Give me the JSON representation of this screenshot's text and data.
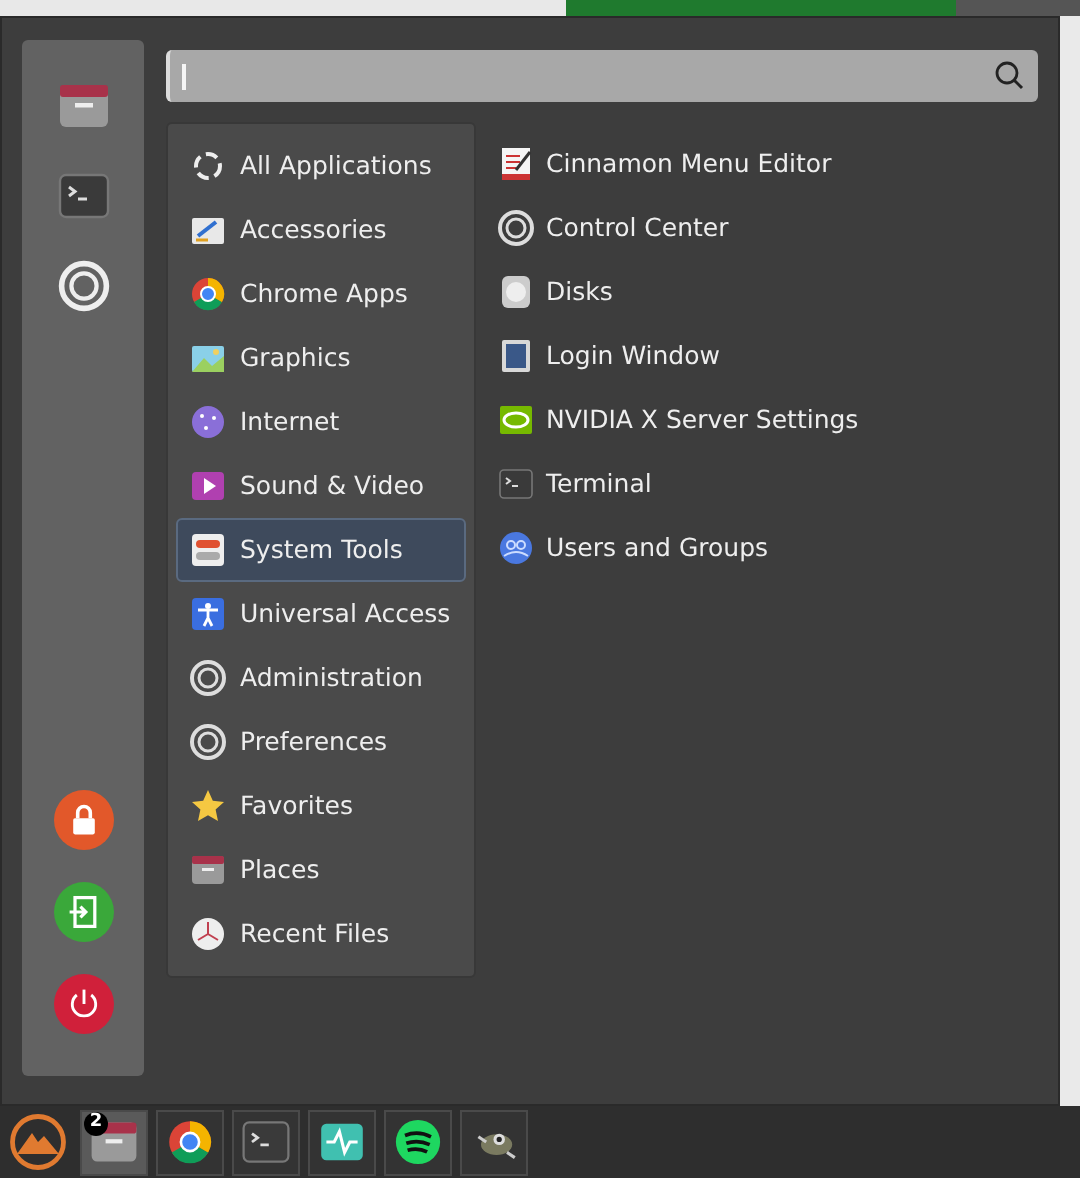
{
  "categories": [
    {
      "label": "All Applications",
      "selected": false
    },
    {
      "label": "Accessories",
      "selected": false
    },
    {
      "label": "Chrome Apps",
      "selected": false
    },
    {
      "label": "Graphics",
      "selected": false
    },
    {
      "label": "Internet",
      "selected": false
    },
    {
      "label": "Sound & Video",
      "selected": false
    },
    {
      "label": "System Tools",
      "selected": true
    },
    {
      "label": "Universal Access",
      "selected": false
    },
    {
      "label": "Administration",
      "selected": false
    },
    {
      "label": "Preferences",
      "selected": false
    },
    {
      "label": "Favorites",
      "selected": false
    },
    {
      "label": "Places",
      "selected": false
    },
    {
      "label": "Recent Files",
      "selected": false
    }
  ],
  "applications": [
    "Cinnamon Menu Editor",
    "Control Center",
    "Disks",
    "Login Window",
    "NVIDIA X Server Settings",
    "Terminal",
    "Users and Groups"
  ],
  "taskbar": {
    "file_manager_badge": "2"
  }
}
